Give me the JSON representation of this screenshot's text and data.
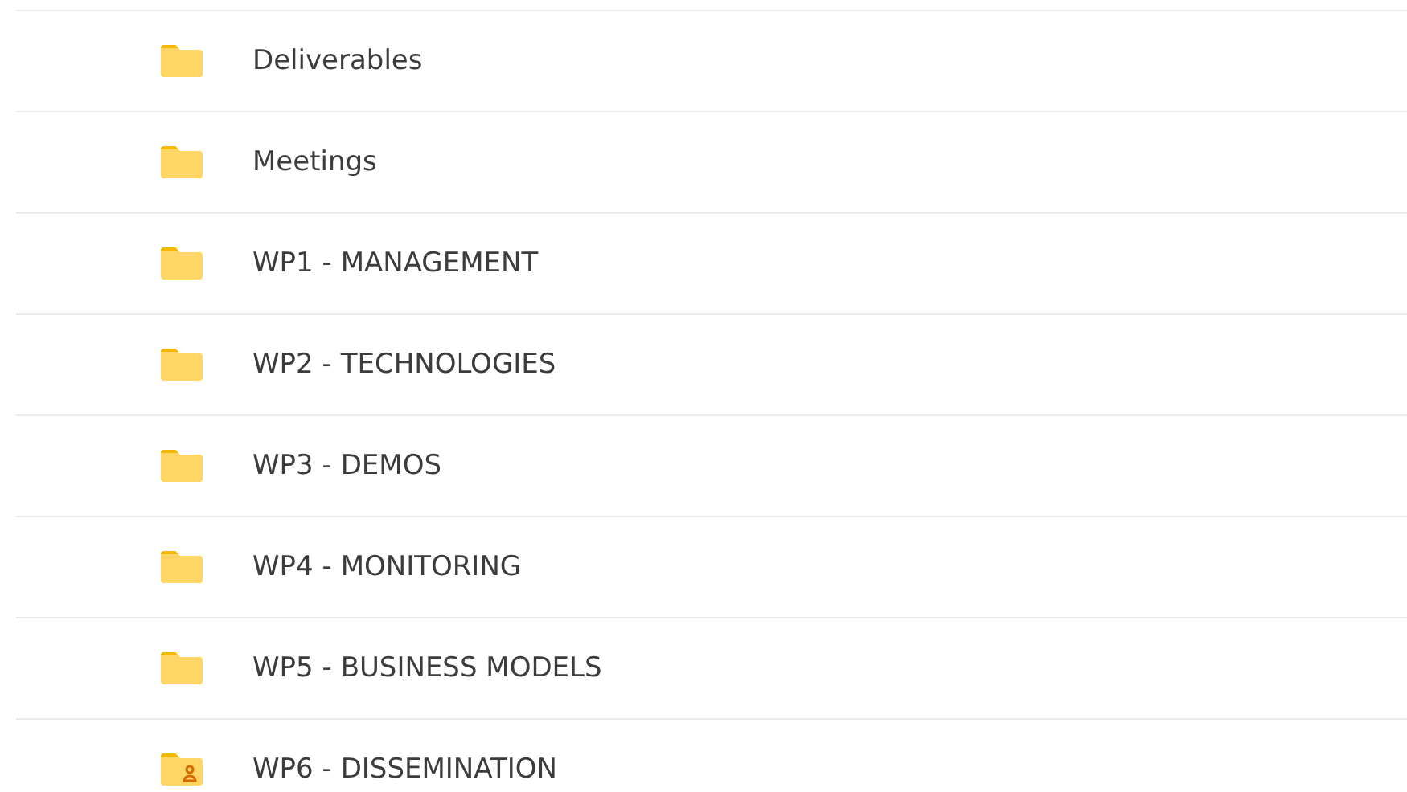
{
  "folders": [
    {
      "name": "Deliverables",
      "kind": "folder"
    },
    {
      "name": "Meetings",
      "kind": "folder"
    },
    {
      "name": "WP1 - MANAGEMENT",
      "kind": "folder"
    },
    {
      "name": "WP2 - TECHNOLOGIES",
      "kind": "folder"
    },
    {
      "name": "WP3 - DEMOS",
      "kind": "folder"
    },
    {
      "name": "WP4 - MONITORING",
      "kind": "folder"
    },
    {
      "name": "WP5 - BUSINESS MODELS",
      "kind": "folder"
    },
    {
      "name": "WP6 - DISSEMINATION",
      "kind": "shared"
    }
  ]
}
